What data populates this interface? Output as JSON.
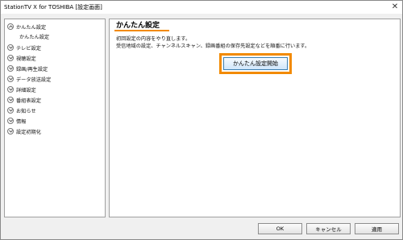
{
  "window": {
    "title": "StationTV X for TOSHIBA [設定画面]",
    "close": "✕"
  },
  "sidebar": {
    "items": [
      {
        "label": "かんたん設定",
        "expanded": true
      },
      {
        "label": "テレビ設定"
      },
      {
        "label": "視聴設定"
      },
      {
        "label": "録画/再生設定"
      },
      {
        "label": "データ放送設定"
      },
      {
        "label": "詳細設定"
      },
      {
        "label": "番組表設定"
      },
      {
        "label": "お知らせ"
      },
      {
        "label": "情報"
      },
      {
        "label": "設定初期化"
      }
    ],
    "sub_item": "かんたん設定"
  },
  "content": {
    "heading": "かんたん設定",
    "desc_line1": "初回設定の内容をやり直します。",
    "desc_line2": "受信地域の設定、チャンネルスキャン、録画番組の保存先設定などを順番に行います。",
    "start_button": "かんたん設定開始",
    "accent_color": "#f28a00"
  },
  "buttons": {
    "ok": "OK",
    "cancel": "キャンセル",
    "apply": "適用"
  }
}
